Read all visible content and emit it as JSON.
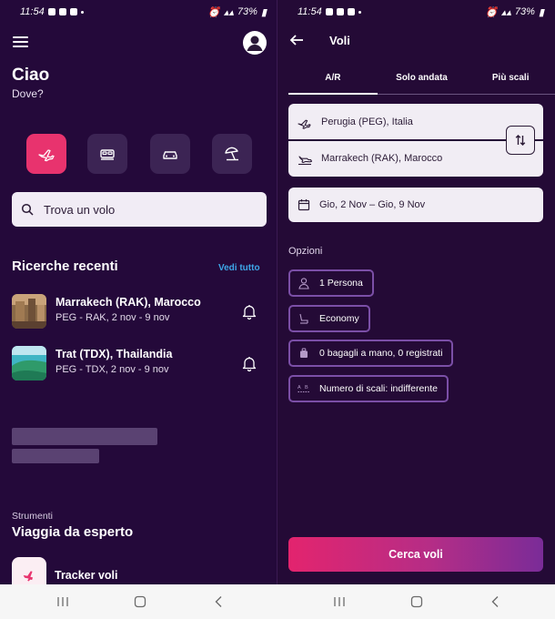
{
  "left": {
    "status": {
      "time": "11:54",
      "battery": "73%"
    },
    "greeting": "Ciao",
    "greeting_sub": "Dove?",
    "categories": [
      "plane-icon",
      "bed-icon",
      "car-icon",
      "beach-umbrella-icon"
    ],
    "search": {
      "label": "Trova un volo"
    },
    "recent": {
      "title": "Ricerche recenti",
      "see_all": "Vedi tutto",
      "items": [
        {
          "title": "Marrakech (RAK), Marocco",
          "sub": "PEG - RAK, 2 nov - 9 nov"
        },
        {
          "title": "Trat (TDX), Thailandia",
          "sub": "PEG - TDX, 2 nov - 9 nov"
        }
      ]
    },
    "tools": {
      "label": "Strumenti",
      "title": "Viaggia da esperto",
      "tracker": "Tracker voli"
    }
  },
  "right": {
    "status": {
      "time": "11:54",
      "battery": "73%"
    },
    "title": "Voli",
    "tabs": [
      "A/R",
      "Solo andata",
      "Più scali"
    ],
    "active_tab": "A/R",
    "origin": "Perugia (PEG), Italia",
    "destination": "Marrakech (RAK), Marocco",
    "dates": "Gio, 2 Nov  –  Gio, 9 Nov",
    "options_label": "Opzioni",
    "options": {
      "passengers": "1 Persona",
      "cabin": "Economy",
      "bags": "0 bagagli a mano, 0 registrati",
      "stops": "Numero di scali: indifferente"
    },
    "cta": "Cerca voli"
  },
  "colors": {
    "background": "#240a36",
    "accent_pink": "#e8336e",
    "link_blue": "#3ea7e8",
    "chip_border": "#7b4fa7"
  }
}
